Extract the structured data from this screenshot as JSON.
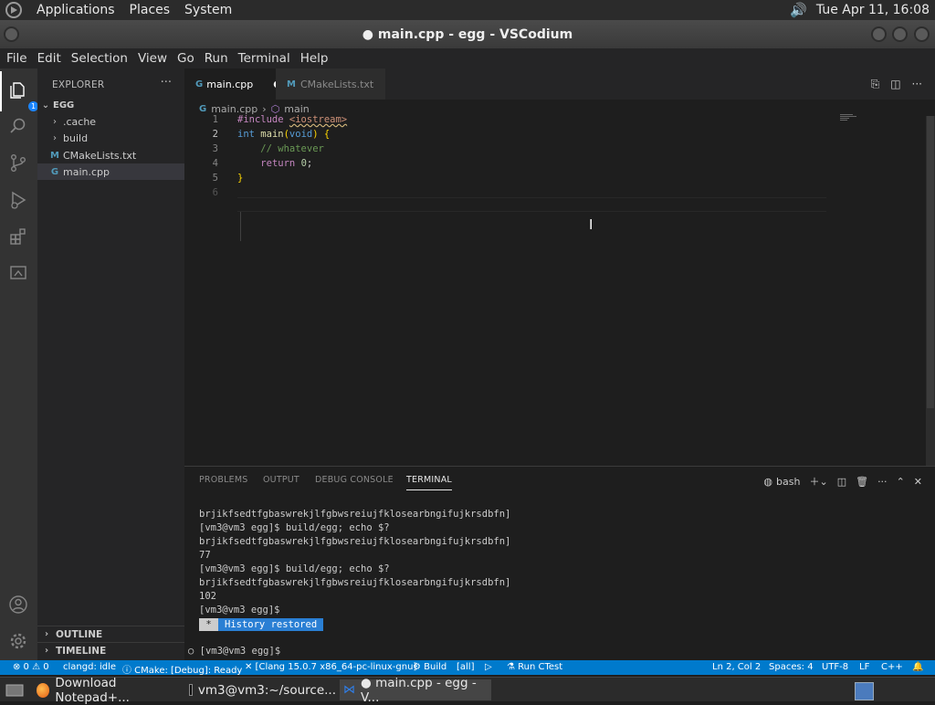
{
  "top_panel": {
    "menus": [
      "Applications",
      "Places",
      "System"
    ],
    "clock": "Tue Apr 11, 16:08"
  },
  "window": {
    "title": "● main.cpp - egg - VSCodium"
  },
  "menubar": [
    "File",
    "Edit",
    "Selection",
    "View",
    "Go",
    "Run",
    "Terminal",
    "Help"
  ],
  "activity": {
    "explorer_badge": "1"
  },
  "sidebar": {
    "title": "EXPLORER",
    "root": "EGG",
    "items": [
      ".cache",
      "build",
      "CMakeLists.txt",
      "main.cpp"
    ],
    "outline": "OUTLINE",
    "timeline": "TIMELINE"
  },
  "tabs": [
    {
      "label": "main.cpp",
      "dirty": "●"
    },
    {
      "label": "CMakeLists.txt"
    }
  ],
  "breadcrumb": {
    "file": "main.cpp",
    "symbol": "main"
  },
  "code": {
    "line_numbers": [
      "1",
      "2",
      "3",
      "4",
      "5",
      "6"
    ],
    "l1_directive": "#include",
    "l1_header": "<iostream>",
    "l2_kw": "int",
    "l2_fn": "main",
    "l2_param": "void",
    "l2_brace": "{",
    "l3_comment": "// whatever",
    "l4_kw": "return",
    "l4_num": "0",
    "l5_brace": "}"
  },
  "panel": {
    "tabs": [
      "PROBLEMS",
      "OUTPUT",
      "DEBUG CONSOLE",
      "TERMINAL"
    ],
    "shell": "bash",
    "lines": [
      "brjikfsedtfgbaswrekjlfgbwsreiujfklosearbngifujkrsdbfn]",
      "[vm3@vm3 egg]$ build/egg; echo $?",
      "brjikfsedtfgbaswrekjlfgbwsreiujfklosearbngifujkrsdbfn]",
      "77",
      "[vm3@vm3 egg]$ build/egg; echo $?",
      "brjikfsedtfgbaswrekjlfgbwsreiujfklosearbngifujkrsdbfn]",
      "102",
      "[vm3@vm3 egg]$"
    ],
    "history_star": "*",
    "history_msg": "History restored",
    "prompt": "○ [vm3@vm3 egg]$"
  },
  "statusbar": {
    "problems": "⊗ 0 ⚠ 0",
    "clangd": "clangd: idle",
    "cmake": "ⓘ CMake: [Debug]: Ready",
    "kit": "✕ [Clang 15.0.7 x86_64-pc-linux-gnu]",
    "build": "⚙ Build",
    "target": "[all]",
    "run": "▷",
    "ctest": "⚗ Run CTest",
    "position": "Ln 2, Col 2",
    "spaces": "Spaces: 4",
    "encoding": "UTF-8",
    "eol": "LF",
    "language": "C++"
  },
  "taskbar": {
    "items": [
      "Download Notepad+...",
      "vm3@vm3:~/source...",
      "● main.cpp - egg - V..."
    ]
  }
}
